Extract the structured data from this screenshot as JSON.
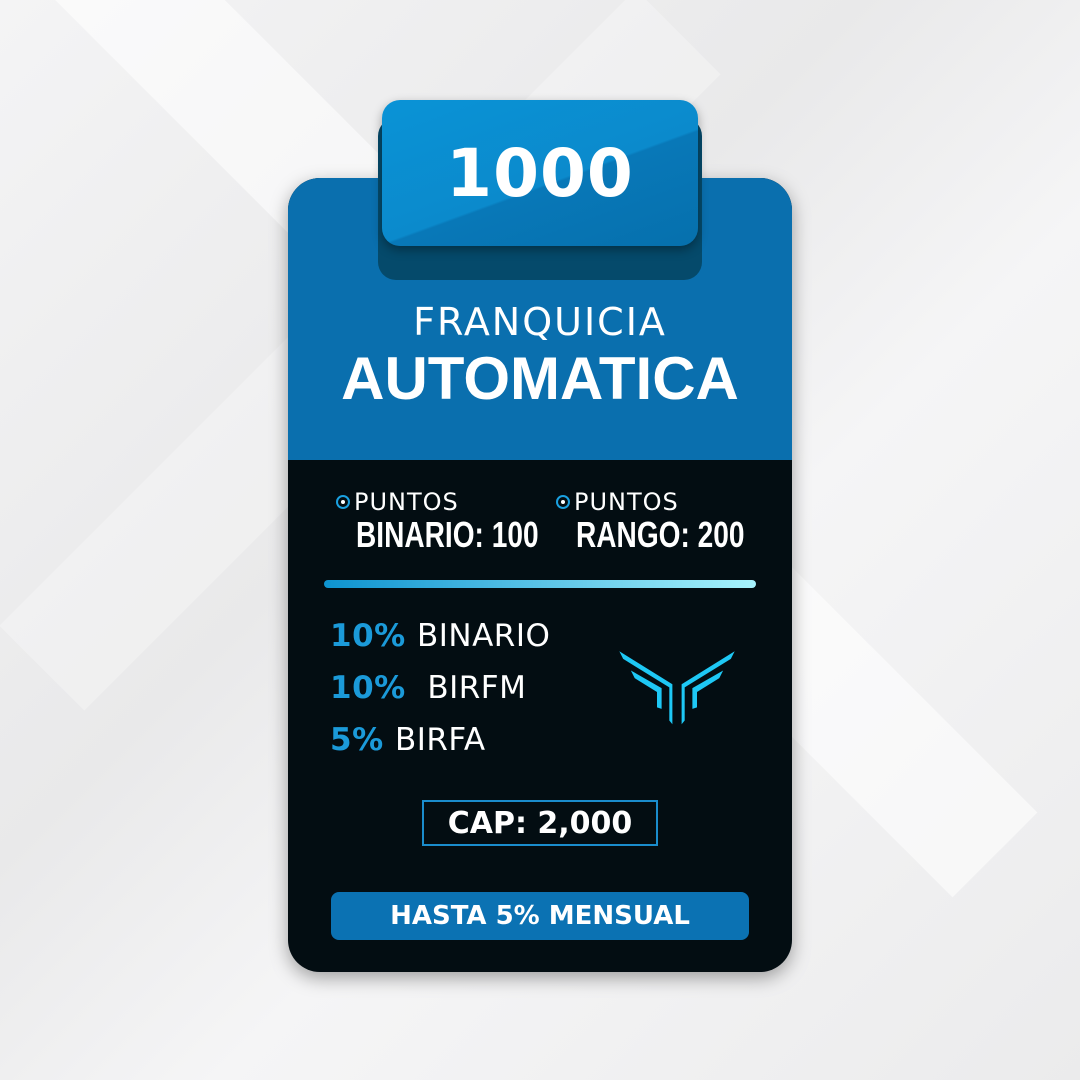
{
  "tab_number": "1000",
  "title_line1": "FRANQUICIA",
  "title_line2": "AUTOMATICA",
  "points": [
    {
      "label": "PUNTOS",
      "value": "BINARIO: 100"
    },
    {
      "label": "PUNTOS",
      "value": "RANGO: 200"
    }
  ],
  "bonuses": [
    {
      "percent": "10%",
      "name": "BINARIO"
    },
    {
      "percent": "10%",
      "name": " BIRFM"
    },
    {
      "percent": "5%",
      "name": "BIRFA"
    }
  ],
  "cap": "CAP: 2,000",
  "monthly": "HASTA 5% MENSUAL",
  "logo_icon": "winged-y-logo",
  "colors": {
    "blue": "#0a6fae",
    "tab_blue": "#0a93d6",
    "dark": "#030d12",
    "accent": "#1ec8f5"
  }
}
